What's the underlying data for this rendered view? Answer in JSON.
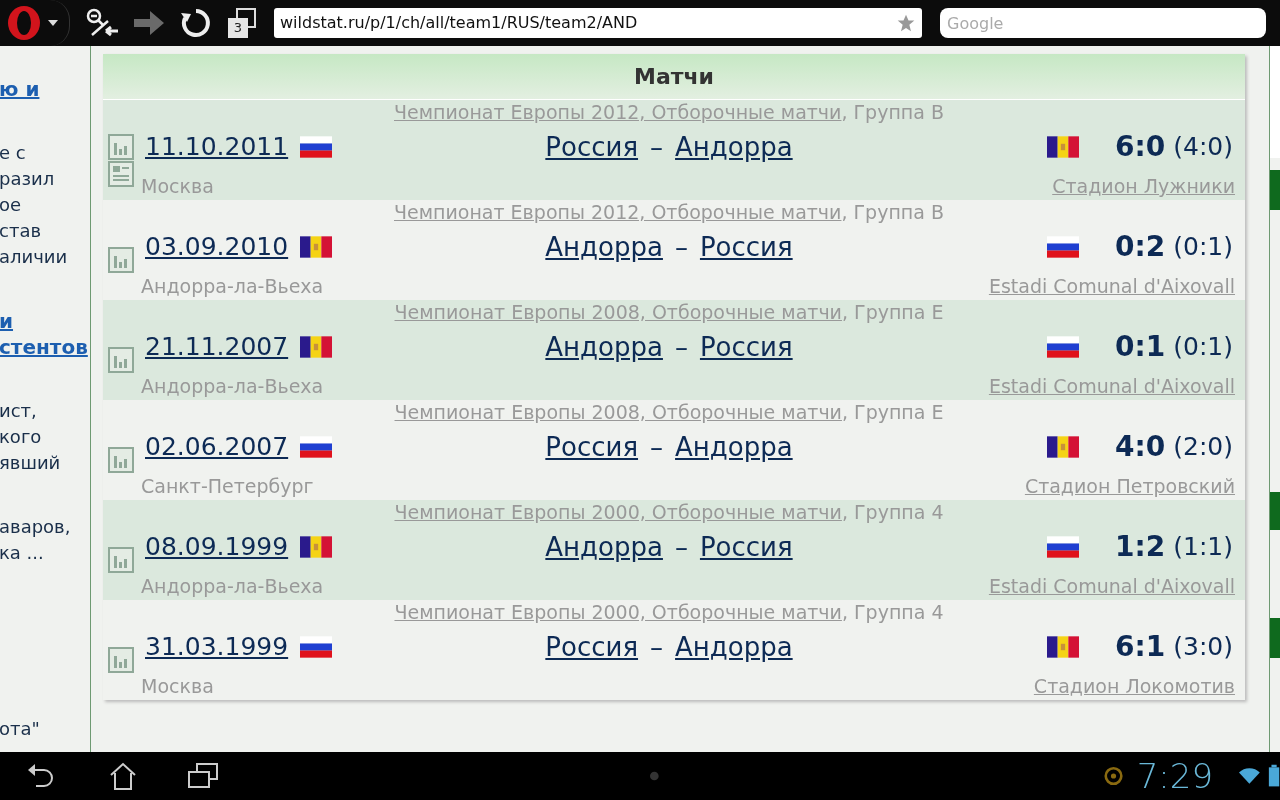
{
  "browser": {
    "tab_count": "3",
    "url": "wildstat.ru/p/1/ch/all/team1/RUS/team2/AND",
    "search_placeholder": "Google",
    "forward_disabled": true
  },
  "left_column": [
    {
      "kind": "link",
      "lines": [
        "ю и"
      ]
    },
    {
      "kind": "text",
      "lines": [
        "е с",
        "разил",
        "ое",
        "став",
        "аличии"
      ]
    },
    {
      "kind": "link",
      "lines": [
        "и",
        "стентов"
      ]
    },
    {
      "kind": "text",
      "lines": [
        "ист,",
        "кого",
        "явший"
      ]
    },
    {
      "kind": "text",
      "lines": [
        "аваров,",
        "ка ..."
      ]
    },
    {
      "kind": "text",
      "lines": [
        "ота\""
      ]
    }
  ],
  "table": {
    "title": "Матчи",
    "rows": [
      {
        "tournament": "Чемпионат Европы 2012, Отборочные матчи",
        "group": ", Группа B",
        "date": "11.10.2011",
        "home_flag": {
          "kind": "russia"
        },
        "home": "Россия",
        "dash": "–",
        "away": "Андорра",
        "away_flag": {
          "kind": "andorra"
        },
        "score": "6:0",
        "halftime": "(4:0)",
        "city": "Москва",
        "stadium": "Стадион Лужники",
        "has_report": true
      },
      {
        "tournament": "Чемпионат Европы 2012, Отборочные матчи",
        "group": ", Группа B",
        "date": "03.09.2010",
        "home_flag": {
          "kind": "andorra"
        },
        "home": "Андорра",
        "dash": "–",
        "away": "Россия",
        "away_flag": {
          "kind": "russia"
        },
        "score": "0:2",
        "halftime": "(0:1)",
        "city": "Андорра-ла-Вьеха",
        "stadium": "Estadi Comunal d'Aixovall",
        "has_report": false
      },
      {
        "tournament": "Чемпионат Европы 2008, Отборочные матчи",
        "group": ", Группа E",
        "date": "21.11.2007",
        "home_flag": {
          "kind": "andorra"
        },
        "home": "Андорра",
        "dash": "–",
        "away": "Россия",
        "away_flag": {
          "kind": "russia"
        },
        "score": "0:1",
        "halftime": "(0:1)",
        "city": "Андорра-ла-Вьеха",
        "stadium": "Estadi Comunal d'Aixovall",
        "has_report": false
      },
      {
        "tournament": "Чемпионат Европы 2008, Отборочные матчи",
        "group": ", Группа E",
        "date": "02.06.2007",
        "home_flag": {
          "kind": "russia"
        },
        "home": "Россия",
        "dash": "–",
        "away": "Андорра",
        "away_flag": {
          "kind": "andorra"
        },
        "score": "4:0",
        "halftime": "(2:0)",
        "city": "Санкт-Петербург",
        "stadium": "Стадион Петровский",
        "has_report": false
      },
      {
        "tournament": "Чемпионат Европы 2000, Отборочные матчи",
        "group": ", Группа 4",
        "date": "08.09.1999",
        "home_flag": {
          "kind": "andorra"
        },
        "home": "Андорра",
        "dash": "–",
        "away": "Россия",
        "away_flag": {
          "kind": "russia"
        },
        "score": "1:2",
        "halftime": "(1:1)",
        "city": "Андорра-ла-Вьеха",
        "stadium": "Estadi Comunal d'Aixovall",
        "has_report": false
      },
      {
        "tournament": "Чемпионат Европы 2000, Отборочные матчи",
        "group": ", Группа 4",
        "date": "31.03.1999",
        "home_flag": {
          "kind": "russia"
        },
        "home": "Россия",
        "dash": "–",
        "away": "Андорра",
        "away_flag": {
          "kind": "andorra"
        },
        "score": "6:1",
        "halftime": "(3:0)",
        "city": "Москва",
        "stadium": "Стадион Локомотив",
        "has_report": false
      }
    ]
  },
  "status_bar": {
    "time": "7:29"
  }
}
